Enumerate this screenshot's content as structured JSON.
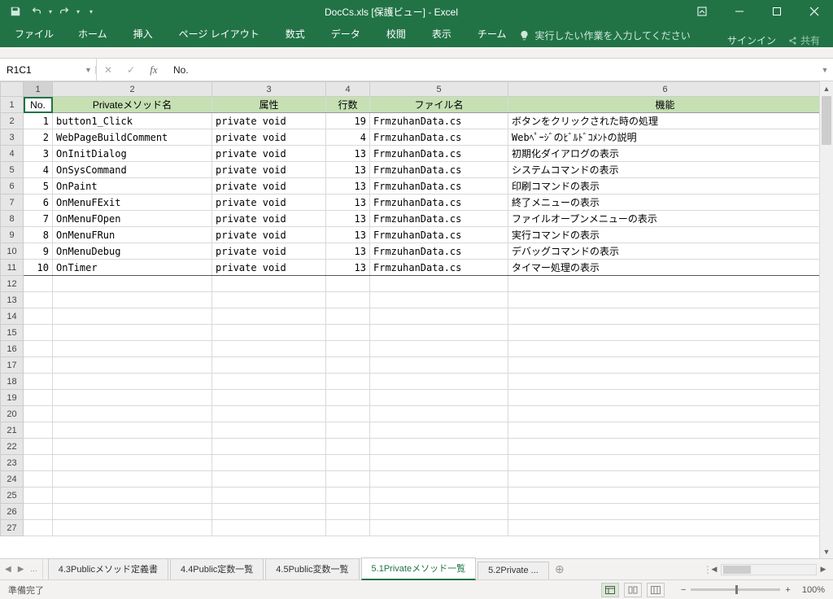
{
  "window": {
    "title": "DocCs.xls  [保護ビュー] - Excel"
  },
  "ribbon": {
    "tabs": [
      "ファイル",
      "ホーム",
      "挿入",
      "ページ レイアウト",
      "数式",
      "データ",
      "校閲",
      "表示",
      "チーム"
    ],
    "tellme": "実行したい作業を入力してください",
    "signin": "サインイン",
    "share": "共有"
  },
  "namebox": "R1C1",
  "formula": "No.",
  "col_headers": [
    "1",
    "2",
    "3",
    "4",
    "5",
    "6"
  ],
  "header_row": [
    "No.",
    "Privateメソッド名",
    "属性",
    "行数",
    "ファイル名",
    "機能"
  ],
  "rows": [
    {
      "no": "1",
      "name": "button1_Click",
      "attr": "private void",
      "lines": "19",
      "file": "FrmzuhanData.cs",
      "func": "ボタンをクリックされた時の処理"
    },
    {
      "no": "2",
      "name": "WebPageBuildComment",
      "attr": "private void",
      "lines": "4",
      "file": "FrmzuhanData.cs",
      "func": "Webﾍﾟｰｼﾞのﾋﾞﾙﾄﾞｺﾒﾝﾄの説明"
    },
    {
      "no": "3",
      "name": "OnInitDialog",
      "attr": "private void",
      "lines": "13",
      "file": "FrmzuhanData.cs",
      "func": "初期化ダイアログの表示"
    },
    {
      "no": "4",
      "name": "OnSysCommand",
      "attr": "private void",
      "lines": "13",
      "file": "FrmzuhanData.cs",
      "func": "システムコマンドの表示"
    },
    {
      "no": "5",
      "name": "OnPaint",
      "attr": "private void",
      "lines": "13",
      "file": "FrmzuhanData.cs",
      "func": "印刷コマンドの表示"
    },
    {
      "no": "6",
      "name": "OnMenuFExit",
      "attr": "private void",
      "lines": "13",
      "file": "FrmzuhanData.cs",
      "func": "終了メニューの表示"
    },
    {
      "no": "7",
      "name": "OnMenuFOpen",
      "attr": "private void",
      "lines": "13",
      "file": "FrmzuhanData.cs",
      "func": "ファイルオープンメニューの表示"
    },
    {
      "no": "8",
      "name": "OnMenuFRun",
      "attr": "private void",
      "lines": "13",
      "file": "FrmzuhanData.cs",
      "func": "実行コマンドの表示"
    },
    {
      "no": "9",
      "name": "OnMenuDebug",
      "attr": "private void",
      "lines": "13",
      "file": "FrmzuhanData.cs",
      "func": "デバッグコマンドの表示"
    },
    {
      "no": "10",
      "name": "OnTimer",
      "attr": "private void",
      "lines": "13",
      "file": "FrmzuhanData.cs",
      "func": "タイマー処理の表示"
    }
  ],
  "empty_rows": 16,
  "sheet_tabs": {
    "items": [
      "4.3Publicメソッド定義書",
      "4.4Public定数一覧",
      "4.5Public変数一覧",
      "5.1Privateメソッド一覧",
      "5.2Private ..."
    ],
    "active": 3,
    "ellipsis": "..."
  },
  "status": {
    "ready": "準備完了",
    "zoom": "100%"
  }
}
